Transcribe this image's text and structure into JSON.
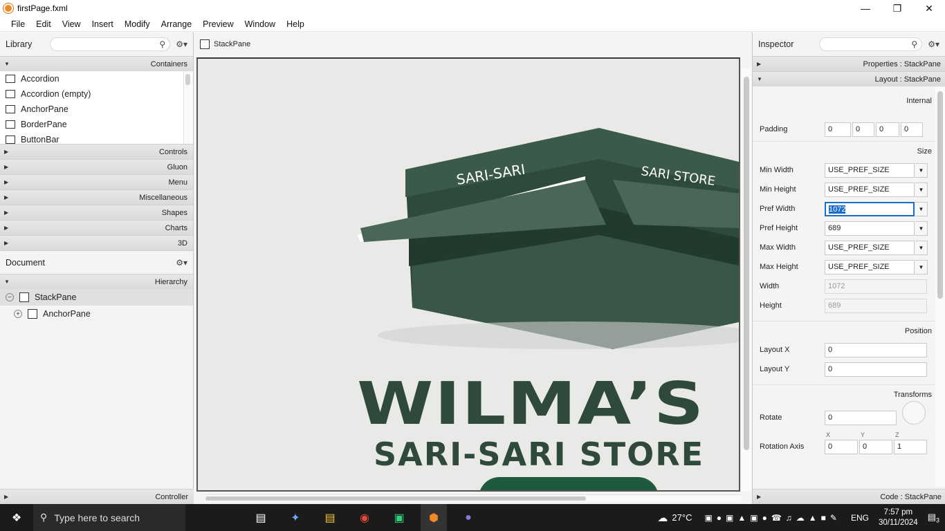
{
  "window": {
    "title": "firstPage.fxml"
  },
  "menu": [
    "File",
    "Edit",
    "View",
    "Insert",
    "Modify",
    "Arrange",
    "Preview",
    "Window",
    "Help"
  ],
  "library": {
    "title": "Library",
    "containers_label": "Containers",
    "items": [
      "Accordion",
      "Accordion  (empty)",
      "AnchorPane",
      "BorderPane",
      "ButtonBar"
    ],
    "sections": [
      "Controls",
      "Gluon",
      "Menu",
      "Miscellaneous",
      "Shapes",
      "Charts",
      "3D"
    ]
  },
  "document": {
    "title": "Document",
    "hierarchy_label": "Hierarchy",
    "tree": [
      {
        "label": "StackPane"
      },
      {
        "label": "AnchorPane"
      }
    ],
    "controller_label": "Controller"
  },
  "center": {
    "breadcrumb": "StackPane",
    "image_text": {
      "heading": "WILMA’S",
      "sub": "SARI-SARI STORE",
      "sign1": "SARI-SARI",
      "sign2": "SARI STORE"
    }
  },
  "inspector": {
    "title": "Inspector",
    "properties_label": "Properties : StackPane",
    "layout_label": "Layout : StackPane",
    "code_label": "Code : StackPane",
    "internal_label": "Internal",
    "padding": {
      "label": "Padding",
      "values": [
        "0",
        "0",
        "0",
        "0"
      ]
    },
    "size_label": "Size",
    "size_rows": [
      {
        "label": "Min Width",
        "value": "USE_PREF_SIZE"
      },
      {
        "label": "Min Height",
        "value": "USE_PREF_SIZE"
      },
      {
        "label": "Pref Width",
        "value": "1072"
      },
      {
        "label": "Pref Height",
        "value": "689"
      },
      {
        "label": "Max Width",
        "value": "USE_PREF_SIZE"
      },
      {
        "label": "Max Height",
        "value": "USE_PREF_SIZE"
      }
    ],
    "width": {
      "label": "Width",
      "value": "1072"
    },
    "height": {
      "label": "Height",
      "value": "689"
    },
    "position_label": "Position",
    "layout_x": {
      "label": "Layout X",
      "value": "0"
    },
    "layout_y": {
      "label": "Layout Y",
      "value": "0"
    },
    "transforms_label": "Transforms",
    "rotate": {
      "label": "Rotate",
      "value": "0"
    },
    "rotation_axis": {
      "label": "Rotation Axis",
      "x": "0",
      "y": "0",
      "z": "1",
      "hx": "X",
      "hy": "Y",
      "hz": "Z"
    }
  },
  "taskbar": {
    "search_placeholder": "Type here to search",
    "temperature": "27°C",
    "language": "ENG",
    "time": "7:57 pm",
    "date": "30/11/2024",
    "notif_count": "3"
  }
}
